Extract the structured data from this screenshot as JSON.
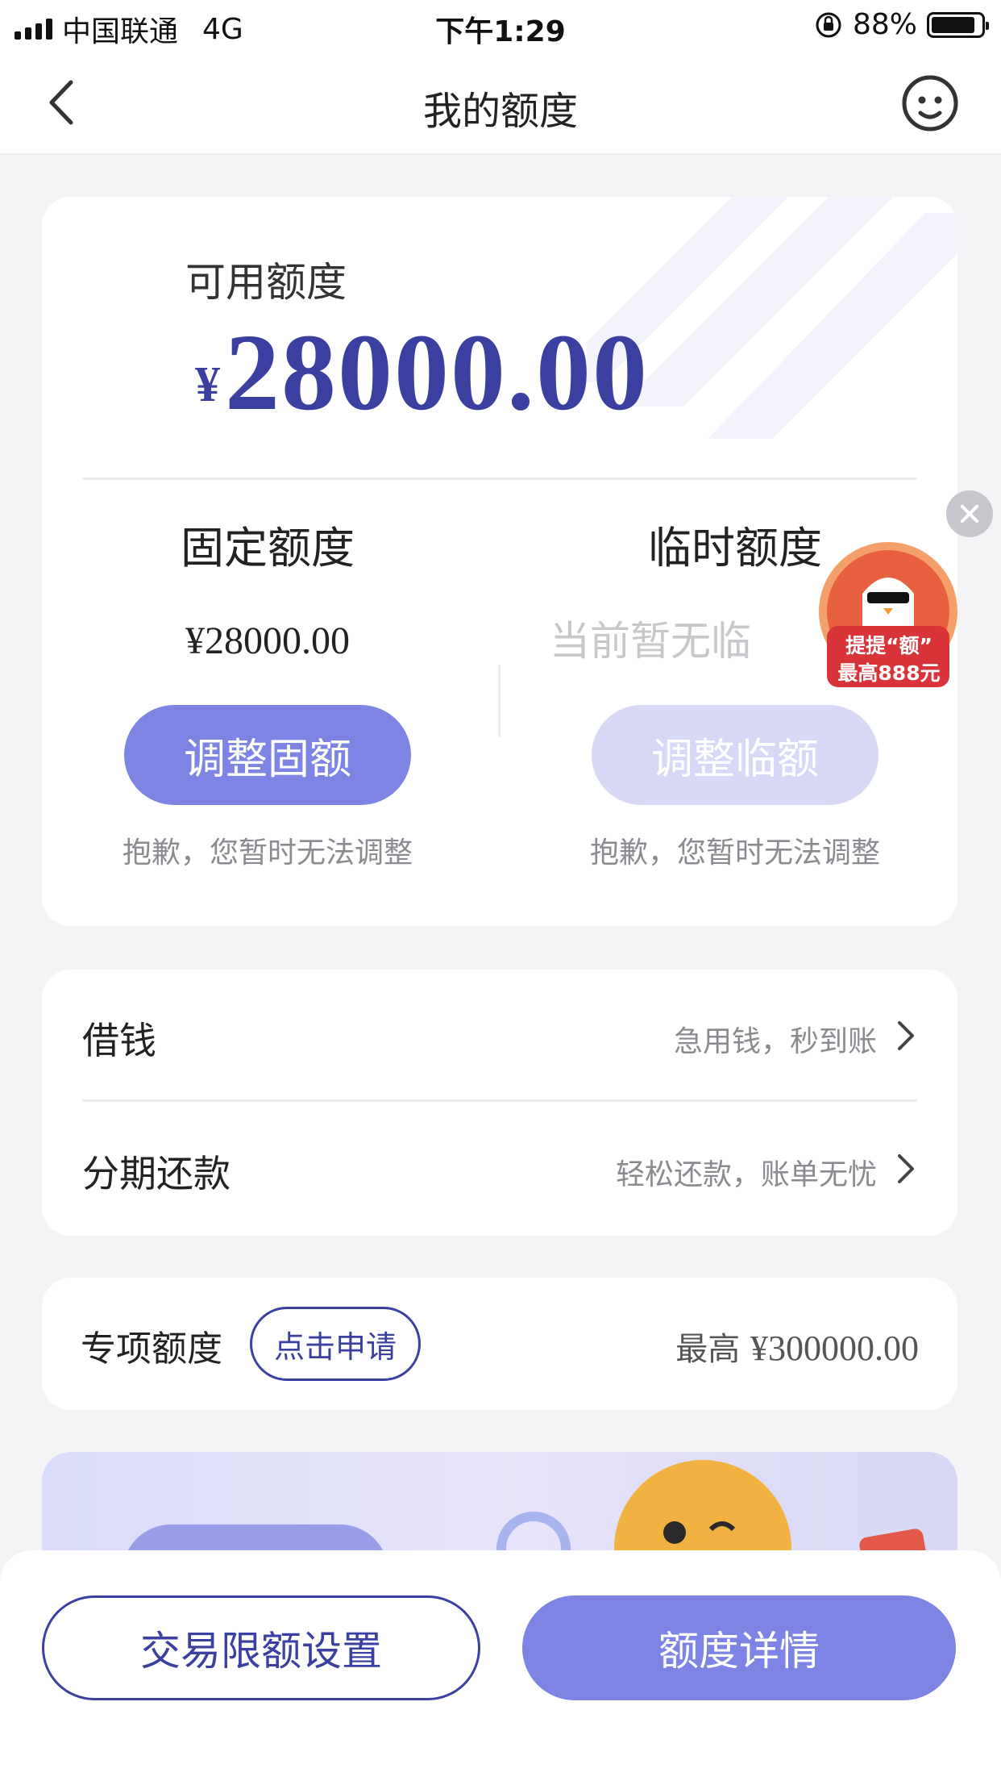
{
  "status_bar": {
    "carrier": "中国联通",
    "network": "4G",
    "time": "下午1:29",
    "battery": "88%",
    "battery_level": 0.88
  },
  "nav": {
    "title": "我的额度",
    "back_icon": "chevron-left-icon",
    "service_icon": "customer-service-icon"
  },
  "quota": {
    "available_label": "可用额度",
    "currency": "¥",
    "available_amount": "28000.00",
    "fixed": {
      "title": "固定额度",
      "value": "¥28000.00",
      "button": "调整固额",
      "note": "抱歉，您暂时无法调整"
    },
    "temporary": {
      "title": "临时额度",
      "value": "当前暂无临",
      "button": "调整临额",
      "note": "抱歉，您暂时无法调整"
    }
  },
  "promo": {
    "line1": "提提“额”",
    "line2": "最高888元"
  },
  "menu": [
    {
      "label": "借钱",
      "desc": "急用钱，秒到账"
    },
    {
      "label": "分期还款",
      "desc": "轻松还款，账单无忧"
    }
  ],
  "special": {
    "label": "专项额度",
    "button": "点击申请",
    "prefix": "最高",
    "amount": "¥300000.00"
  },
  "bottom": {
    "left_button": "交易限额设置",
    "right_button": "额度详情"
  },
  "colors": {
    "brand": "#3b3fa0",
    "button": "#7e84e4",
    "button_disabled": "#d7d9f7",
    "background": "#f4f4f7"
  }
}
